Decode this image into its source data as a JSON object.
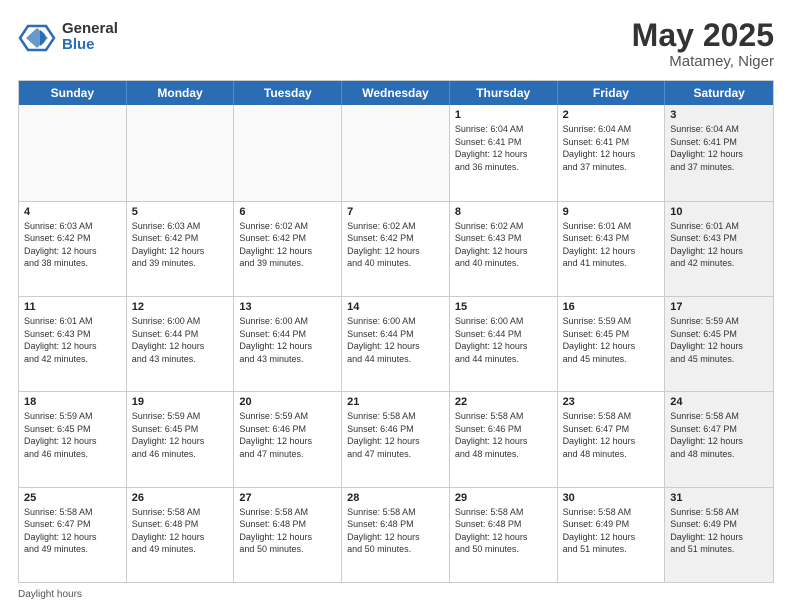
{
  "logo": {
    "general": "General",
    "blue": "Blue"
  },
  "title": "May 2025",
  "subtitle": "Matamey, Niger",
  "days_of_week": [
    "Sunday",
    "Monday",
    "Tuesday",
    "Wednesday",
    "Thursday",
    "Friday",
    "Saturday"
  ],
  "footer": "Daylight hours",
  "weeks": [
    [
      {
        "day": "",
        "info": "",
        "empty": true
      },
      {
        "day": "",
        "info": "",
        "empty": true
      },
      {
        "day": "",
        "info": "",
        "empty": true
      },
      {
        "day": "",
        "info": "",
        "empty": true
      },
      {
        "day": "1",
        "info": "Sunrise: 6:04 AM\nSunset: 6:41 PM\nDaylight: 12 hours\nand 36 minutes.",
        "empty": false
      },
      {
        "day": "2",
        "info": "Sunrise: 6:04 AM\nSunset: 6:41 PM\nDaylight: 12 hours\nand 37 minutes.",
        "empty": false
      },
      {
        "day": "3",
        "info": "Sunrise: 6:04 AM\nSunset: 6:41 PM\nDaylight: 12 hours\nand 37 minutes.",
        "empty": false,
        "shaded": true
      }
    ],
    [
      {
        "day": "4",
        "info": "Sunrise: 6:03 AM\nSunset: 6:42 PM\nDaylight: 12 hours\nand 38 minutes.",
        "empty": false
      },
      {
        "day": "5",
        "info": "Sunrise: 6:03 AM\nSunset: 6:42 PM\nDaylight: 12 hours\nand 39 minutes.",
        "empty": false
      },
      {
        "day": "6",
        "info": "Sunrise: 6:02 AM\nSunset: 6:42 PM\nDaylight: 12 hours\nand 39 minutes.",
        "empty": false
      },
      {
        "day": "7",
        "info": "Sunrise: 6:02 AM\nSunset: 6:42 PM\nDaylight: 12 hours\nand 40 minutes.",
        "empty": false
      },
      {
        "day": "8",
        "info": "Sunrise: 6:02 AM\nSunset: 6:43 PM\nDaylight: 12 hours\nand 40 minutes.",
        "empty": false
      },
      {
        "day": "9",
        "info": "Sunrise: 6:01 AM\nSunset: 6:43 PM\nDaylight: 12 hours\nand 41 minutes.",
        "empty": false
      },
      {
        "day": "10",
        "info": "Sunrise: 6:01 AM\nSunset: 6:43 PM\nDaylight: 12 hours\nand 42 minutes.",
        "empty": false,
        "shaded": true
      }
    ],
    [
      {
        "day": "11",
        "info": "Sunrise: 6:01 AM\nSunset: 6:43 PM\nDaylight: 12 hours\nand 42 minutes.",
        "empty": false
      },
      {
        "day": "12",
        "info": "Sunrise: 6:00 AM\nSunset: 6:44 PM\nDaylight: 12 hours\nand 43 minutes.",
        "empty": false
      },
      {
        "day": "13",
        "info": "Sunrise: 6:00 AM\nSunset: 6:44 PM\nDaylight: 12 hours\nand 43 minutes.",
        "empty": false
      },
      {
        "day": "14",
        "info": "Sunrise: 6:00 AM\nSunset: 6:44 PM\nDaylight: 12 hours\nand 44 minutes.",
        "empty": false
      },
      {
        "day": "15",
        "info": "Sunrise: 6:00 AM\nSunset: 6:44 PM\nDaylight: 12 hours\nand 44 minutes.",
        "empty": false
      },
      {
        "day": "16",
        "info": "Sunrise: 5:59 AM\nSunset: 6:45 PM\nDaylight: 12 hours\nand 45 minutes.",
        "empty": false
      },
      {
        "day": "17",
        "info": "Sunrise: 5:59 AM\nSunset: 6:45 PM\nDaylight: 12 hours\nand 45 minutes.",
        "empty": false,
        "shaded": true
      }
    ],
    [
      {
        "day": "18",
        "info": "Sunrise: 5:59 AM\nSunset: 6:45 PM\nDaylight: 12 hours\nand 46 minutes.",
        "empty": false
      },
      {
        "day": "19",
        "info": "Sunrise: 5:59 AM\nSunset: 6:45 PM\nDaylight: 12 hours\nand 46 minutes.",
        "empty": false
      },
      {
        "day": "20",
        "info": "Sunrise: 5:59 AM\nSunset: 6:46 PM\nDaylight: 12 hours\nand 47 minutes.",
        "empty": false
      },
      {
        "day": "21",
        "info": "Sunrise: 5:58 AM\nSunset: 6:46 PM\nDaylight: 12 hours\nand 47 minutes.",
        "empty": false
      },
      {
        "day": "22",
        "info": "Sunrise: 5:58 AM\nSunset: 6:46 PM\nDaylight: 12 hours\nand 48 minutes.",
        "empty": false
      },
      {
        "day": "23",
        "info": "Sunrise: 5:58 AM\nSunset: 6:47 PM\nDaylight: 12 hours\nand 48 minutes.",
        "empty": false
      },
      {
        "day": "24",
        "info": "Sunrise: 5:58 AM\nSunset: 6:47 PM\nDaylight: 12 hours\nand 48 minutes.",
        "empty": false,
        "shaded": true
      }
    ],
    [
      {
        "day": "25",
        "info": "Sunrise: 5:58 AM\nSunset: 6:47 PM\nDaylight: 12 hours\nand 49 minutes.",
        "empty": false
      },
      {
        "day": "26",
        "info": "Sunrise: 5:58 AM\nSunset: 6:48 PM\nDaylight: 12 hours\nand 49 minutes.",
        "empty": false
      },
      {
        "day": "27",
        "info": "Sunrise: 5:58 AM\nSunset: 6:48 PM\nDaylight: 12 hours\nand 50 minutes.",
        "empty": false
      },
      {
        "day": "28",
        "info": "Sunrise: 5:58 AM\nSunset: 6:48 PM\nDaylight: 12 hours\nand 50 minutes.",
        "empty": false
      },
      {
        "day": "29",
        "info": "Sunrise: 5:58 AM\nSunset: 6:48 PM\nDaylight: 12 hours\nand 50 minutes.",
        "empty": false
      },
      {
        "day": "30",
        "info": "Sunrise: 5:58 AM\nSunset: 6:49 PM\nDaylight: 12 hours\nand 51 minutes.",
        "empty": false
      },
      {
        "day": "31",
        "info": "Sunrise: 5:58 AM\nSunset: 6:49 PM\nDaylight: 12 hours\nand 51 minutes.",
        "empty": false,
        "shaded": true
      }
    ]
  ]
}
